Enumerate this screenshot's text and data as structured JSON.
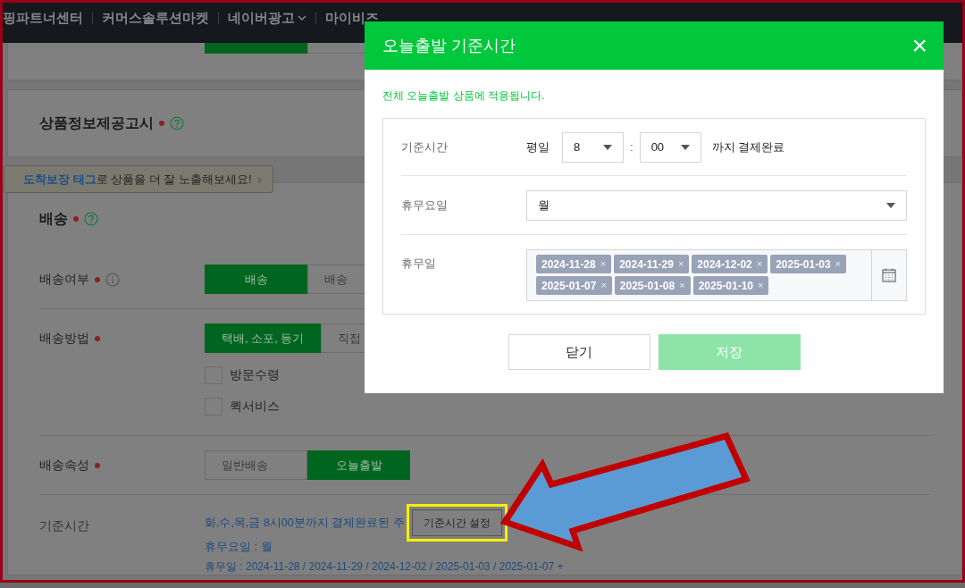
{
  "top_nav": [
    {
      "label": "핑파트너센터",
      "has_caret": false
    },
    {
      "label": "커머스솔루션마켓",
      "has_caret": false
    },
    {
      "label": "네이버광고",
      "has_caret": true
    },
    {
      "label": "마이비즈",
      "has_caret": false
    }
  ],
  "notice_section": {
    "title": "상품정보제공고시",
    "required": true
  },
  "promo_tooltip": {
    "highlight": "도착보장 태그",
    "text": "로 상품을 더 잘 노출해보세요!",
    "arrow": "›"
  },
  "shipping": {
    "title": "배송",
    "required": true,
    "rows": [
      {
        "kind": "toggle",
        "label": "배송여부",
        "required": true,
        "info": true,
        "options": [
          {
            "label": "배송",
            "selected": true
          },
          {
            "label": "배송",
            "selected": false
          }
        ]
      },
      {
        "kind": "toggle",
        "label": "배송방법",
        "required": true,
        "info": false,
        "options": [
          {
            "label": "택배, 소포, 등기",
            "selected": true
          },
          {
            "label": "직접",
            "selected": false
          }
        ],
        "checkboxes": [
          {
            "label": "방문수령",
            "checked": false
          },
          {
            "label": "퀵서비스",
            "checked": false
          }
        ]
      },
      {
        "kind": "toggle",
        "label": "배송속성",
        "required": true,
        "info": false,
        "options": [
          {
            "label": "일반배송",
            "selected": false
          },
          {
            "label": "오늘출발",
            "selected": true
          }
        ]
      },
      {
        "kind": "summary",
        "label": "기준시간",
        "lines": [
          "화,수,목,금 8시00분까지 결제완료된 주",
          "휴무요일 : 월",
          "휴무일 : 2024-11-28 / 2024-11-29 / 2024-12-02 / 2025-01-03 / 2025-01-07 +"
        ],
        "button": "기준시간 설정",
        "highlighted": true
      }
    ]
  },
  "modal": {
    "title": "오늘출발 기준시간",
    "close": "×",
    "note": "전체 오늘출발 상품에 적용됩니다.",
    "cutoff": {
      "label": "기준시간",
      "prefix": "평일",
      "hour": "8",
      "separator": ":",
      "minute": "00",
      "suffix": "까지 결제완료"
    },
    "closed_weekday": {
      "label": "휴무요일",
      "value": "월"
    },
    "holidays": {
      "label": "휴무일",
      "tags": [
        "2024-11-28",
        "2024-11-29",
        "2024-12-02",
        "2025-01-03",
        "2025-01-07",
        "2025-01-08",
        "2025-01-10"
      ],
      "remove": "×"
    },
    "buttons": [
      {
        "label": "닫기",
        "kind": "secondary",
        "disabled": false
      },
      {
        "label": "저장",
        "kind": "primary",
        "disabled": true
      }
    ]
  }
}
